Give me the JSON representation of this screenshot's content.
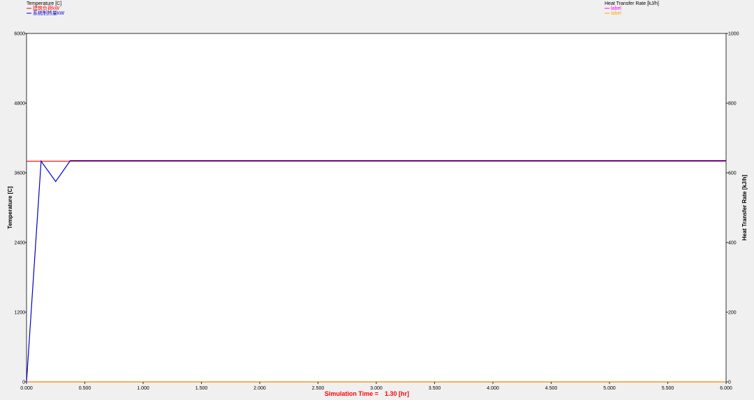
{
  "chart_data": {
    "type": "line",
    "left_axis": {
      "title": "Temperature [C]",
      "legend_title": "Temperature [C]",
      "range": [
        0,
        6000
      ],
      "ticks": [
        0,
        1200,
        2400,
        3600,
        4800,
        6000
      ],
      "tick_labels": [
        "0",
        "1200",
        "2400",
        "3600",
        "4800",
        "6000"
      ]
    },
    "right_axis": {
      "title": "Heat Transfer Rate [kJ/h]",
      "legend_title": "Heat Transfer Rate [kJ/h]",
      "range": [
        0,
        1000
      ],
      "ticks": [
        0,
        200,
        400,
        600,
        800,
        1000
      ],
      "tick_labels": [
        "0",
        "200",
        "400",
        "600",
        "800",
        "1000"
      ]
    },
    "x_axis": {
      "range": [
        0,
        6
      ],
      "ticks": [
        0,
        0.5,
        1,
        1.5,
        2,
        2.5,
        3,
        3.5,
        4,
        4.5,
        5,
        5.5,
        6
      ],
      "tick_labels": [
        "0.000",
        "0.500",
        "1.000",
        "1.500",
        "2.000",
        "2.500",
        "3.000",
        "3.500",
        "4.000",
        "4.500",
        "5.000",
        "5.500",
        "6.000"
      ]
    },
    "series": [
      {
        "name": "建筑负荷kW",
        "axis": "left",
        "color": "#ff0000",
        "x": [
          0,
          6
        ],
        "y": [
          3800,
          3800
        ]
      },
      {
        "name": "系统制热量kW",
        "axis": "left",
        "color": "#0000cc",
        "x": [
          0,
          0.125,
          0.25,
          0.375,
          6
        ],
        "y": [
          0,
          3800,
          3450,
          3810,
          3810
        ]
      },
      {
        "name": "label",
        "axis": "right",
        "color": "#ff00ff",
        "x": [
          0,
          6
        ],
        "y": [
          0,
          0
        ]
      },
      {
        "name": "label",
        "axis": "right",
        "color": "#ffa500",
        "x": [
          0,
          6
        ],
        "y": [
          0,
          0
        ]
      }
    ],
    "footer": {
      "label": "Simulation Time =",
      "value": "1.30 [hr]",
      "color": "#ff0000"
    }
  }
}
